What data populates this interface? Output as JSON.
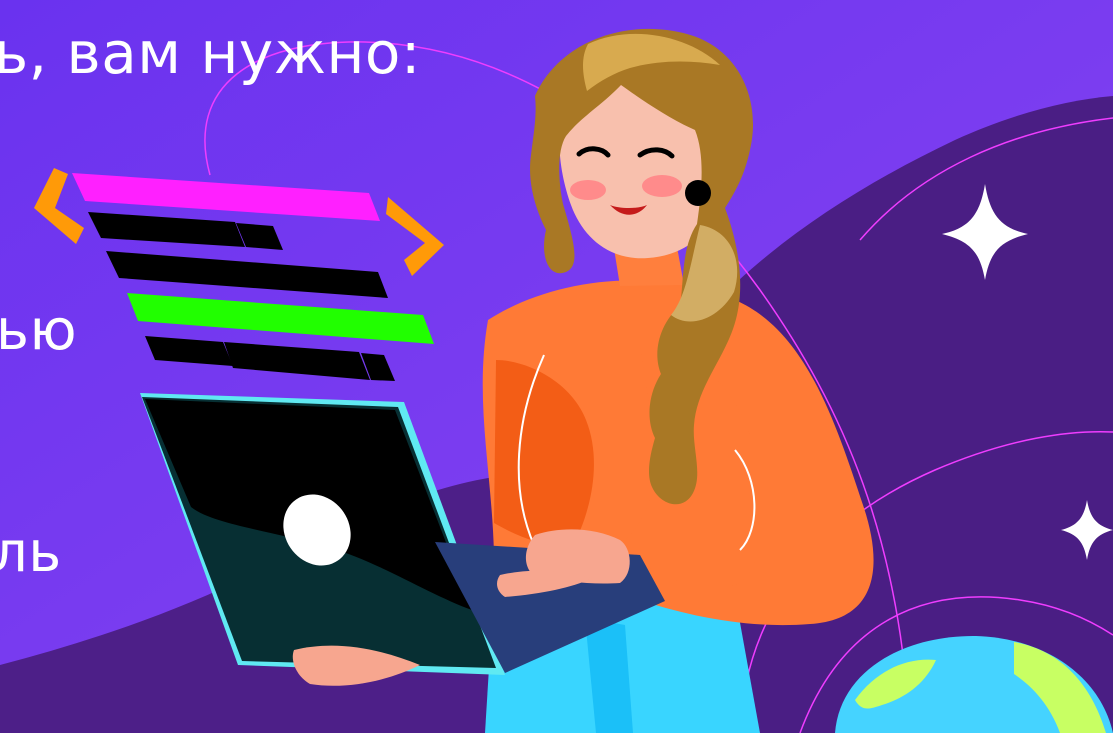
{
  "text": {
    "heading": "ь, вам нужно:",
    "line_1": "ью",
    "line_2": "ль"
  },
  "colors": {
    "background": "#7a3df0",
    "deep_purple": "#4b1d83",
    "magenta_bar": "#ff21ff",
    "green_bar": "#21ff00",
    "orange": "#ff7a36",
    "laptop_dark": "#0f3136",
    "laptop_edge": "#63eff2",
    "planet_blue": "#49d9ff",
    "planet_green": "#c7ff62"
  },
  "icons": {
    "left_code_bracket": "chevron-left-icon",
    "right_code_bracket": "chevron-right-icon",
    "large_star": "sparkle-icon",
    "small_star": "sparkle-icon"
  }
}
